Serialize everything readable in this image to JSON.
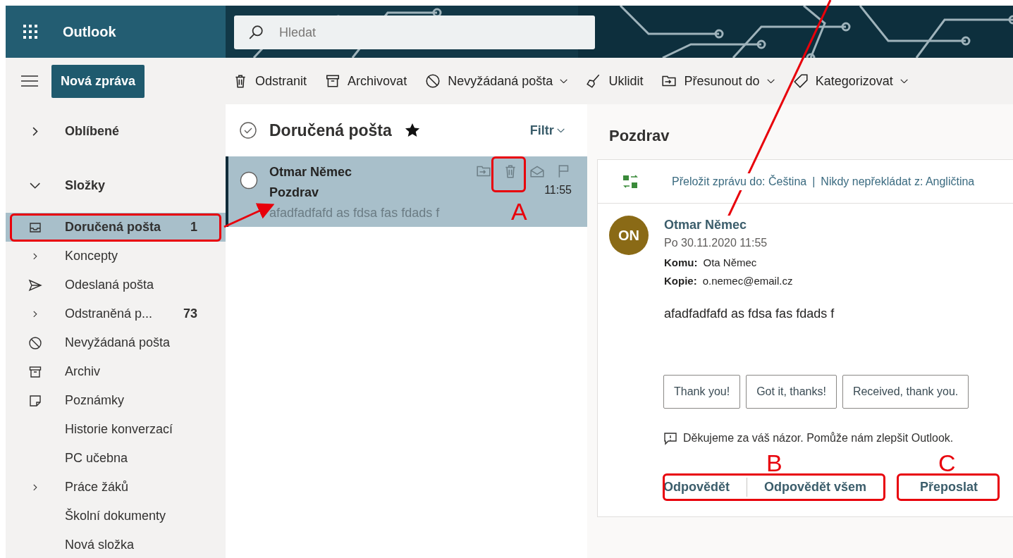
{
  "header": {
    "app_title": "Outlook",
    "search": {
      "placeholder": "Hledat"
    }
  },
  "new_message_button": "Nová zpráva",
  "toolbar": [
    {
      "kind": "trash",
      "label": "Odstranit",
      "dropdown": false
    },
    {
      "kind": "archive",
      "label": "Archivovat",
      "dropdown": false
    },
    {
      "kind": "junk",
      "label": "Nevyžádaná pošta",
      "dropdown": true
    },
    {
      "kind": "broom",
      "label": "Uklidit",
      "dropdown": false
    },
    {
      "kind": "move",
      "label": "Přesunout do",
      "dropdown": true
    },
    {
      "kind": "tag",
      "label": "Kategorizovat",
      "dropdown": true
    }
  ],
  "sidebar": {
    "sections": [
      {
        "label": "Oblíbené",
        "expanded": false
      },
      {
        "label": "Složky",
        "expanded": true,
        "children": [
          {
            "kind": "inbox",
            "label": "Doručená pošta",
            "count": "1",
            "selected": true
          },
          {
            "kind": "expand",
            "label": "Koncepty",
            "selected": false
          },
          {
            "kind": "sent",
            "label": "Odeslaná pošta",
            "selected": false
          },
          {
            "kind": "expand",
            "label": "Odstraněná p...",
            "count": "73",
            "selected": false
          },
          {
            "kind": "junk",
            "label": "Nevyžádaná pošta",
            "selected": false
          },
          {
            "kind": "archive",
            "label": "Archiv",
            "selected": false
          },
          {
            "kind": "note",
            "label": "Poznámky",
            "selected": false
          },
          {
            "kind": "plain",
            "label": "Historie konverzací",
            "selected": false
          },
          {
            "kind": "plain",
            "label": "PC učebna",
            "selected": false
          },
          {
            "kind": "expand",
            "label": "Práce žáků",
            "selected": false
          },
          {
            "kind": "plain",
            "label": "Školní dokumenty",
            "selected": false
          },
          {
            "kind": "plain",
            "label": "Nová složka",
            "selected": false
          }
        ]
      }
    ]
  },
  "message_list": {
    "title": "Doručená pošta",
    "favorite": true,
    "filter": "Filtr",
    "messages": [
      {
        "sender": "Otmar Němec",
        "subject": "Pozdrav",
        "preview": "afadfadfafd as fdsa fas fdads f",
        "time": "11:55",
        "selected": true
      }
    ]
  },
  "reading_pane": {
    "subject": "Pozdrav",
    "translate_link": "Přeložit zprávu do: Čeština",
    "separator": "|",
    "never_translate_link": "Nikdy nepřekládat z: Angličtina",
    "sender": "Otmar Němec",
    "initials": "ON",
    "date": "Po 30.11.2020 11:55",
    "to_label": "Komu:",
    "to": "Ota Němec",
    "cc_label": "Kopie:",
    "cc": "o.nemec@email.cz",
    "body": "afadfadfafd as fdsa fas fdads f",
    "quick_replies": [
      "Thank you!",
      "Got it, thanks!",
      "Received, thank you."
    ],
    "feedback": "Děkujeme za váš názor. Pomůže nám zlepšit Outlook.",
    "actions": [
      "Odpovědět",
      "Odpovědět všem",
      "Přeposlat"
    ]
  },
  "annotations": [
    {
      "label": "A"
    },
    {
      "label": "B"
    },
    {
      "label": "C"
    }
  ]
}
